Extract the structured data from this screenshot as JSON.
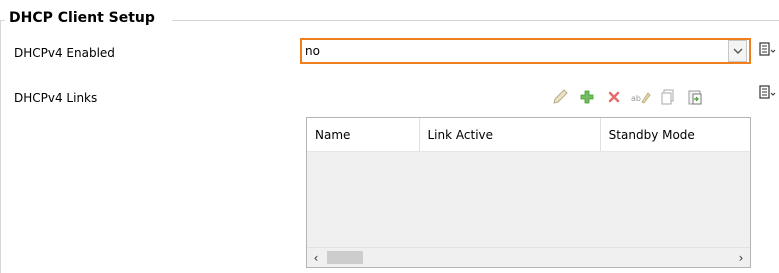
{
  "group": {
    "title": "DHCP Client Setup"
  },
  "dhcpv4_enabled": {
    "label": "DHCPv4 Enabled",
    "value": "no",
    "highlight_color": "#f07f1e"
  },
  "dhcpv4_links": {
    "label": "DHCPv4 Links",
    "toolbar": [
      "edit-icon",
      "add-icon",
      "delete-icon",
      "rename-icon",
      "copy-icon",
      "paste-icon"
    ],
    "columns": [
      "Name",
      "Link Active",
      "Standby Mode"
    ]
  }
}
